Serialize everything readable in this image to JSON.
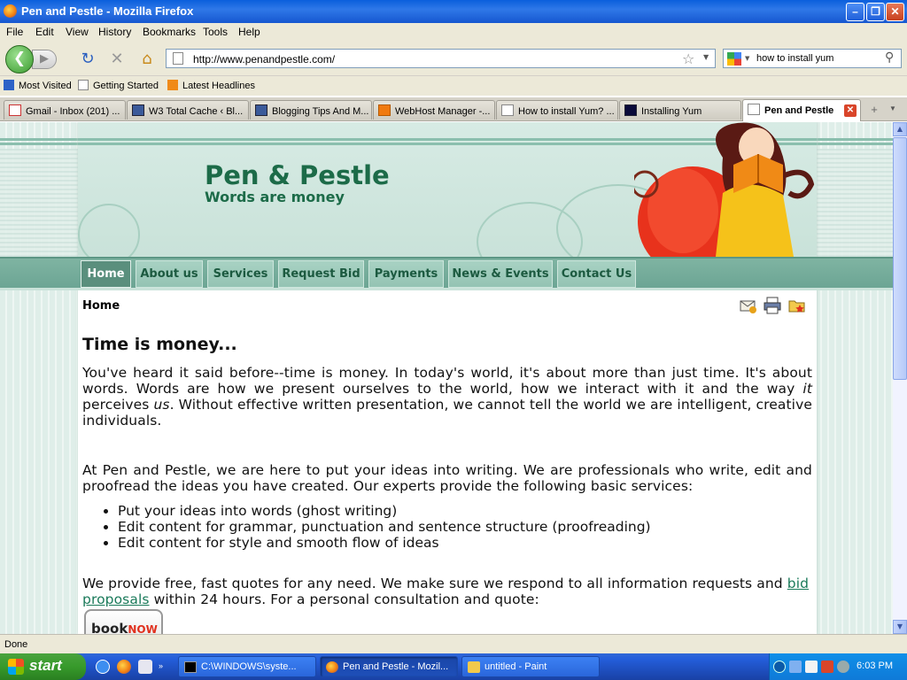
{
  "window": {
    "title": "Pen and Pestle - Mozilla Firefox"
  },
  "menu": [
    "File",
    "Edit",
    "View",
    "History",
    "Bookmarks",
    "Tools",
    "Help"
  ],
  "navbar": {
    "url": "http://www.penandpestle.com/",
    "search": "how to install yum"
  },
  "bookmarks": [
    "Most Visited",
    "Getting Started",
    "Latest Headlines"
  ],
  "tabs": [
    {
      "label": "Gmail - Inbox (201) ..."
    },
    {
      "label": "W3 Total Cache ‹ Bl..."
    },
    {
      "label": "Blogging Tips And M..."
    },
    {
      "label": "WebHost Manager -..."
    },
    {
      "label": "How to install Yum? ..."
    },
    {
      "label": "Installing Yum"
    },
    {
      "label": "Pen and Pestle"
    }
  ],
  "site": {
    "brand_title": "Pen & Pestle",
    "brand_tagline": "Words are money",
    "nav": [
      "Home",
      "About us",
      "Services",
      "Request Bid",
      "Payments",
      "News & Events",
      "Contact Us"
    ],
    "breadcrumb": "Home",
    "heading": "Time is money...",
    "p1_a": "You've heard it said before--time is money. In today's world, it's about more than just time. It's about words.  Words are how we present ourselves to the world, how we interact with it and the way ",
    "p1_it1": "it",
    "p1_b": " perceives ",
    "p1_it2": "us",
    "p1_c": ". Without effective written presentation, we cannot tell the world we are intelligent, creative individuals.",
    "p2": "At Pen and Pestle, we are here to put your ideas into writing. We are professionals who write, edit and proofread the ideas you have created.  Our experts provide the following basic services:",
    "services": [
      "Put your ideas into words (ghost writing)",
      "Edit content for grammar, punctuation and sentence structure (proofreading)",
      "Edit content for style and smooth flow of ideas"
    ],
    "p3_a": "We provide free, fast quotes for any need.  We make sure we respond to all information requests and ",
    "p3_link": "bid proposals",
    "p3_b": " within 24 hours. For a personal consultation and quote:",
    "book_label": "book",
    "book_now": "NOW"
  },
  "status": "Done",
  "taskbar": {
    "start": "start",
    "tasks": [
      "C:\\WINDOWS\\syste...",
      "Pen and Pestle - Mozil...",
      "untitled - Paint"
    ],
    "clock": "6:03 PM"
  }
}
